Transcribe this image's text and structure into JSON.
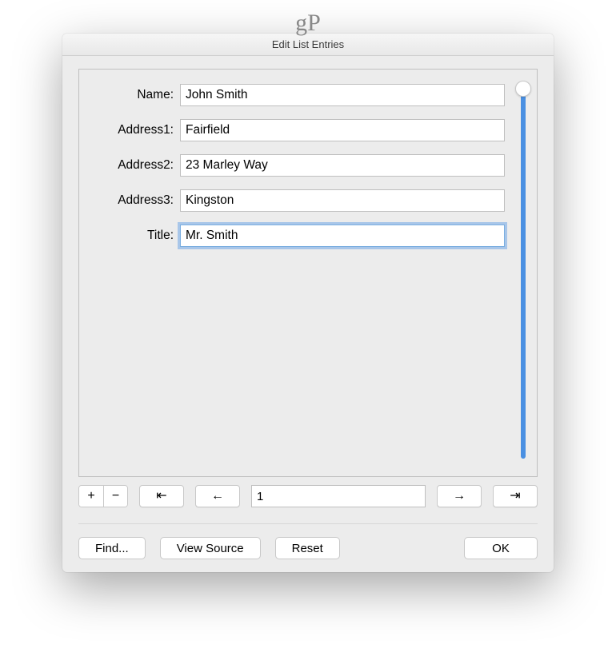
{
  "watermark": "gP",
  "dialog": {
    "title": "Edit List Entries"
  },
  "form": {
    "fields": [
      {
        "label": "Name:",
        "value": "John Smith",
        "focused": false
      },
      {
        "label": "Address1:",
        "value": "Fairfield",
        "focused": false
      },
      {
        "label": "Address2:",
        "value": "23 Marley Way",
        "focused": false
      },
      {
        "label": "Address3:",
        "value": "Kingston",
        "focused": false
      },
      {
        "label": "Title:",
        "value": "Mr. Smith",
        "focused": true
      }
    ]
  },
  "nav": {
    "add": "+",
    "remove": "−",
    "first": "⇤",
    "prev": "←",
    "record": "1",
    "next": "→",
    "last": "⇥"
  },
  "actions": {
    "find": "Find...",
    "view_source": "View Source",
    "reset": "Reset",
    "ok": "OK"
  }
}
